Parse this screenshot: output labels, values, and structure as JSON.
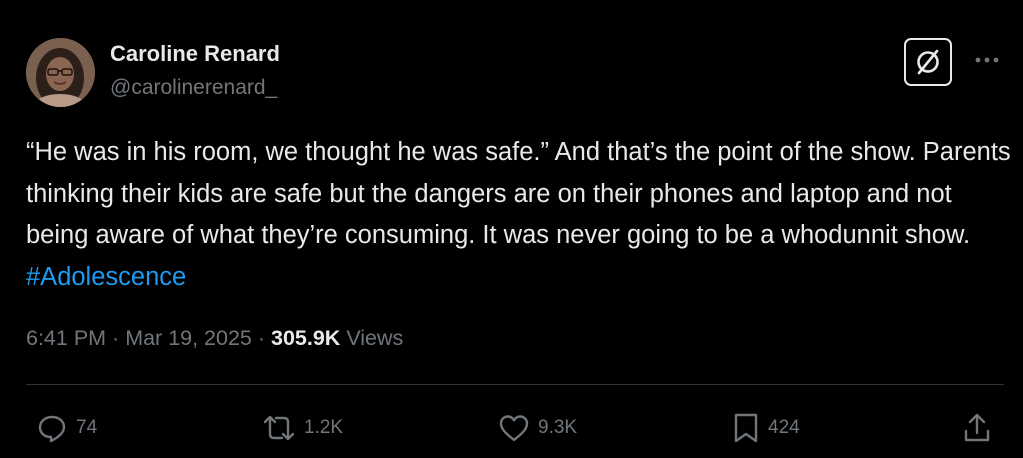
{
  "author": {
    "display_name": "Caroline Renard",
    "handle": "@carolinerenard_"
  },
  "tweet": {
    "text_before_hashtag": "“He was in his room, we thought he was safe.” And that’s the point of the show. Parents thinking their kids are safe but the dangers are on their phones and laptop and not being aware of what they’re consuming. It was never going to be a whodunnit show. ",
    "hashtag": "#Adolescence"
  },
  "meta": {
    "time": "6:41 PM",
    "separator": " · ",
    "date": "Mar 19, 2025",
    "views_count": "305.9K",
    "views_label": " Views"
  },
  "actions": {
    "replies": "74",
    "reposts": "1.2K",
    "likes": "9.3K",
    "bookmarks": "424"
  },
  "icons": {
    "top_right": [
      "grok-icon",
      "more-icon"
    ],
    "actions": [
      "reply-icon",
      "repost-icon",
      "like-icon",
      "bookmark-icon",
      "share-icon"
    ]
  },
  "colors": {
    "background": "#000000",
    "text_primary": "#e7e9ea",
    "text_secondary": "#71767b",
    "link": "#1d9bf0",
    "divider": "#2f3336"
  }
}
